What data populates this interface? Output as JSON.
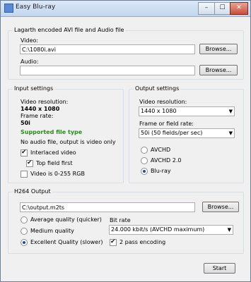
{
  "window": {
    "title": "Easy Blu-ray",
    "controls": [
      "–",
      "☐",
      "✕"
    ]
  },
  "source": {
    "group_title": "Lagarth encoded AVI file and Audio file",
    "video_label": "Video:",
    "video_value": "C:\\1080i.avi",
    "audio_label": "Audio:",
    "audio_value": "",
    "browse_label": "Browse..."
  },
  "input_settings": {
    "group_title": "Input settings",
    "video_resolution_label": "Video resolution:",
    "video_resolution_value": "1440  x 1080",
    "frame_rate_label": "Frame rate:",
    "frame_rate_value": "50i",
    "supported_text": "Supported file type",
    "audio_note": "No audio file, output is video only",
    "interlaced_label": "Interlaced video",
    "interlaced_checked": true,
    "top_field_label": "Top field first",
    "top_field_checked": true,
    "range_label": "Video is 0-255 RGB",
    "range_checked": false
  },
  "output_settings": {
    "group_title": "Output settings",
    "video_resolution_label": "Video resolution:",
    "video_resolution_selected": "1440 x 1080",
    "frame_rate_label": "Frame or field rate:",
    "frame_rate_selected": "50i (50 fields/per sec)",
    "formats": [
      {
        "label": "AVCHD",
        "selected": false
      },
      {
        "label": "AVCHD 2.0",
        "selected": false
      },
      {
        "label": "Blu-ray",
        "selected": true
      }
    ]
  },
  "h264": {
    "group_title": "H264 Output",
    "output_value": "C:\\output.m2ts",
    "browse_label": "Browse...",
    "quality_options": [
      {
        "label": "Average quality (quicker)",
        "selected": false
      },
      {
        "label": "Medium quality",
        "selected": false
      },
      {
        "label": "Excellent Quality (slower)",
        "selected": true
      }
    ],
    "bitrate_label": "Bit rate",
    "bitrate_selected": "24.000 kbit/s (AVCHD maximum)",
    "two_pass_label": "2 pass encoding",
    "two_pass_checked": true
  },
  "start_label": "Start"
}
